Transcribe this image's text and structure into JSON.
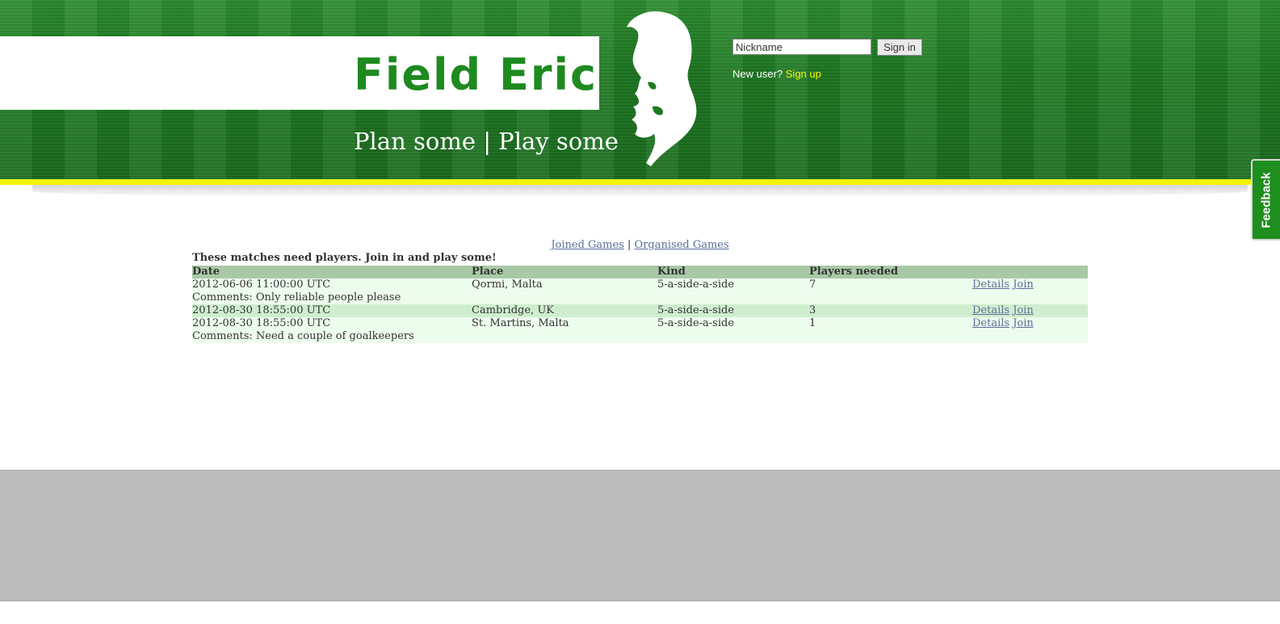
{
  "header": {
    "logo_text": "Field Eric",
    "tagline": "Plan some | Play some",
    "mascot": "footballer-silhouette"
  },
  "signin": {
    "nickname_value": "Nickname",
    "nickname_placeholder": "Nickname",
    "signin_label": "Sign in",
    "newuser_text": "New user?",
    "signup_label": "Sign up"
  },
  "feedback_label": "Feedback",
  "nav": {
    "joined_label": "Joined Games",
    "separator": "|",
    "organised_label": "Organised Games"
  },
  "intro": "These matches need players. Join in and play some!",
  "table": {
    "headers": [
      "Date",
      "Place",
      "Kind",
      "Players needed",
      ""
    ],
    "rows": [
      {
        "date": "2012-06-06 11:00:00 UTC",
        "place": "Qormi, Malta",
        "kind": "5-a-side-a-side",
        "players_needed": "7",
        "details_label": "Details",
        "join_label": "Join",
        "comments": "Comments: Only reliable people please"
      },
      {
        "date": "2012-08-30 18:55:00 UTC",
        "place": "Cambridge, UK",
        "kind": "5-a-side-a-side",
        "players_needed": "3",
        "details_label": "Details",
        "join_label": "Join",
        "comments": ""
      },
      {
        "date": "2012-08-30 18:55:00 UTC",
        "place": "St. Martins, Malta",
        "kind": "5-a-side-a-side",
        "players_needed": "1",
        "details_label": "Details",
        "join_label": "Join",
        "comments": "Comments: Need a couple of goalkeepers"
      }
    ]
  },
  "colors": {
    "header_green": "#1f7a23",
    "logo_green": "#1e8a1f",
    "stripe_yellow": "#f7f400",
    "table_header": "#a9c9a6",
    "row_light": "#edfded",
    "row_dark": "#cfeecf",
    "footer_gray": "#bcbcbc"
  }
}
